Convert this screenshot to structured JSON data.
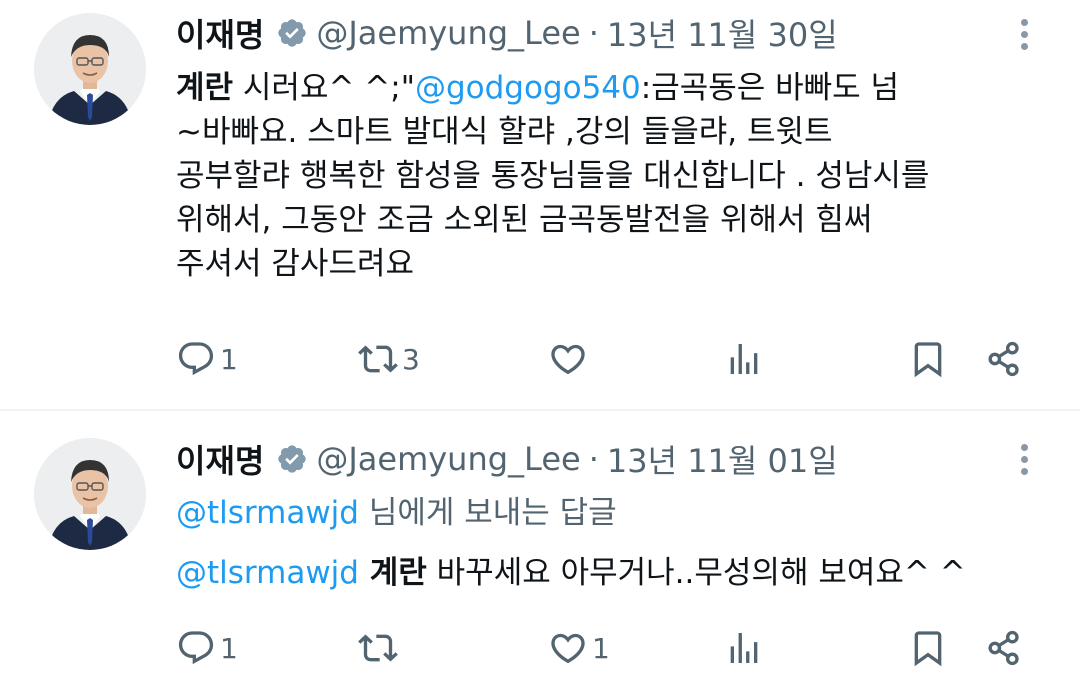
{
  "tweets": [
    {
      "author_name": "이재명",
      "handle": "@Jaemyung_Lee",
      "separator": "·",
      "date": "13년 11월 30일",
      "lines": [
        {
          "bold": "계란",
          "text": " 시러요^ ^;\"",
          "mention": "@godgogo540",
          "rest": ":금곡동은 바빠도 넘"
        },
        {
          "text": "~바빠요.  스마트 발대식 할랴 ,강의 들을랴,  트윗트"
        },
        {
          "text": "공부할랴  행복한 함성을 통장님들을 대신합니다 . 성남시를"
        },
        {
          "text": "위해서,  그동안 조금 소외된 금곡동발전을 위해서 힘써"
        },
        {
          "text": "주셔서 감사드려요"
        }
      ],
      "actions": {
        "reply_count": "1",
        "retweet_count": "3",
        "like_count": "",
        "views_count": ""
      }
    },
    {
      "author_name": "이재명",
      "handle": "@Jaemyung_Lee",
      "separator": "·",
      "date": "13년 11월 01일",
      "replying_mention": "@tlsrmawjd",
      "replying_text": " 님에게 보내는 답글",
      "body_mention": "@tlsrmawjd",
      "body_bold": " 계란",
      "body_text": " 바꾸세요 아무거나..무성의해 보여요^ ^",
      "actions": {
        "reply_count": "1",
        "retweet_count": "",
        "like_count": "1",
        "views_count": ""
      }
    }
  ],
  "colors": {
    "accent": "#1d9bf0",
    "muted": "#536471",
    "text": "#0f1419",
    "verified": "#829aab"
  },
  "icons": [
    "reply-icon",
    "retweet-icon",
    "like-icon",
    "views-icon",
    "bookmark-icon",
    "share-icon",
    "verified-badge-icon",
    "more-icon"
  ]
}
